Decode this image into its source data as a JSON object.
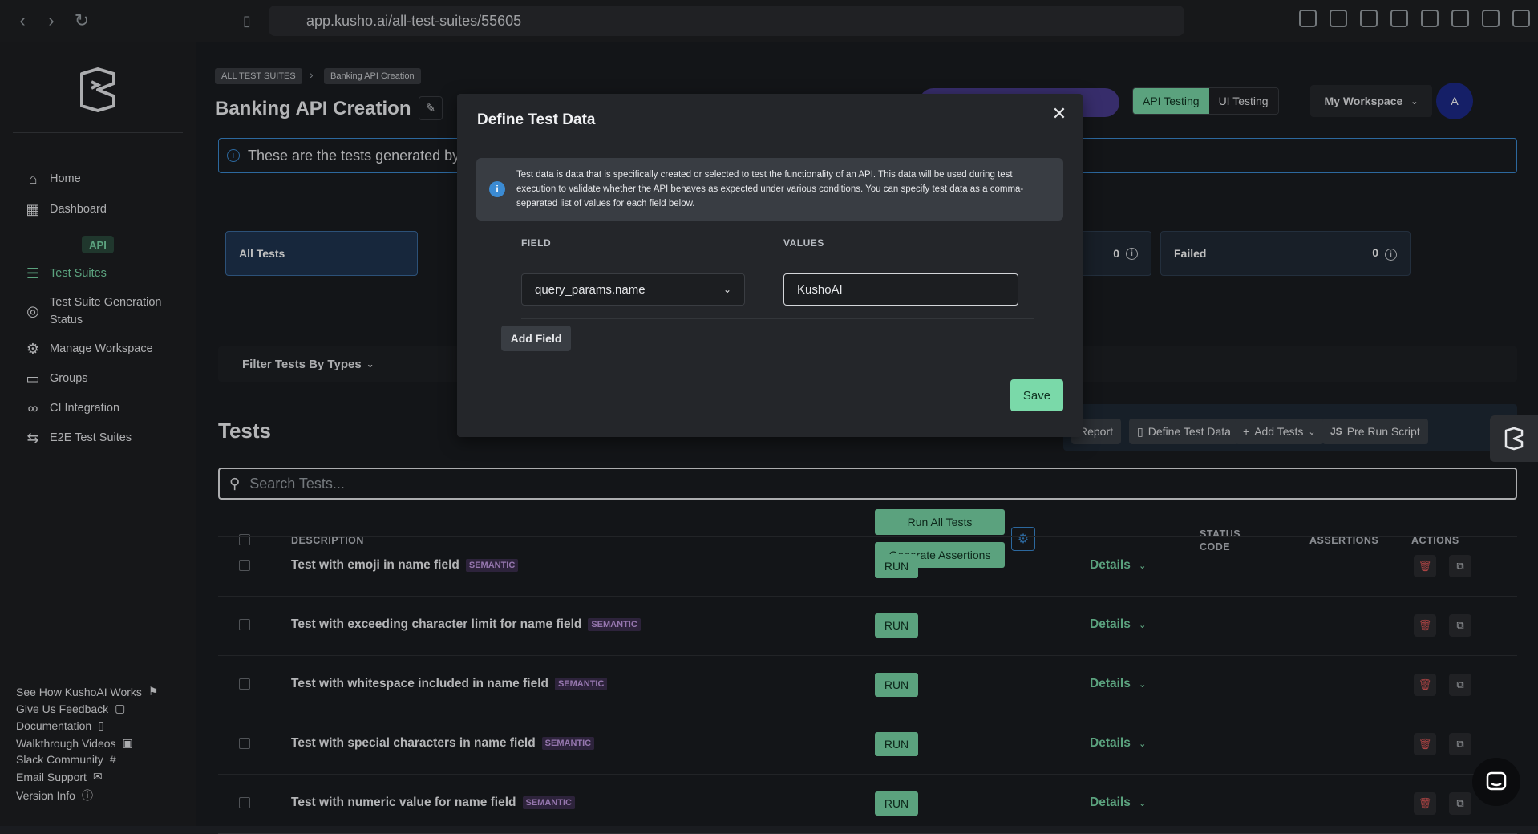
{
  "browser": {
    "url": "app.kusho.ai/all-test-suites/55605"
  },
  "sidebar": {
    "items": [
      {
        "label": "Home",
        "icon": "home-icon"
      },
      {
        "label": "Dashboard",
        "icon": "dashboard-icon"
      }
    ],
    "api_badge": "API",
    "api_items": [
      {
        "label": "Test Suites",
        "icon": "list-check-icon"
      },
      {
        "label": "Test Suite Generation Status",
        "icon": "circle-check-icon"
      },
      {
        "label": "Manage Workspace",
        "icon": "gear-icon"
      },
      {
        "label": "Groups",
        "icon": "folder-icon"
      },
      {
        "label": "CI Integration",
        "icon": "infinity-icon"
      },
      {
        "label": "E2E Test Suites",
        "icon": "e2e-icon"
      }
    ],
    "footer_links": [
      {
        "label": "See How KushoAI Works",
        "icon": "flag-icon"
      },
      {
        "label": "Give Us Feedback",
        "icon": "message-icon"
      },
      {
        "label": "Documentation",
        "icon": "book-icon"
      },
      {
        "label": "Walkthrough Videos",
        "icon": "video-icon"
      },
      {
        "label": "Slack Community",
        "icon": "slack-icon"
      },
      {
        "label": "Email Support",
        "icon": "mail-icon"
      },
      {
        "label": "Version Info",
        "icon": "info-icon"
      }
    ]
  },
  "header": {
    "breadcrumb": [
      "ALL TEST SUITES",
      "Banking API Creation"
    ],
    "title": "Banking API Creation",
    "mode_tabs": [
      "API Testing",
      "UI Testing"
    ],
    "workspace": "My Workspace",
    "avatar": "A"
  },
  "info_bar": "These are the tests generated by K",
  "stats": {
    "all_label": "All Tests",
    "mid_value": "0",
    "failed_label": "Failed",
    "failed_value": "0"
  },
  "filter_label": "Filter Tests By Types",
  "tests_section": {
    "title": "Tests",
    "toolbar": [
      {
        "label": "Report",
        "icon": ""
      },
      {
        "label": "Define Test Data",
        "icon": "file-icon"
      },
      {
        "label": "Add Tests",
        "icon": "plus-icon"
      },
      {
        "label": "Pre Run Script",
        "icon": "js-icon"
      }
    ],
    "search_placeholder": "Search Tests...",
    "columns": {
      "description": "DESCRIPTION",
      "status_code": "STATUS CODE",
      "assertions": "ASSERTIONS",
      "actions": "ACTIONS"
    },
    "run_all": "Run All Tests",
    "generate_assertions": "Generate Assertions",
    "rows": [
      {
        "name": "Test with emoji in name field",
        "tag": "SEMANTIC",
        "run": "RUN",
        "details": "Details"
      },
      {
        "name": "Test with exceeding character limit for name field",
        "tag": "SEMANTIC",
        "run": "RUN",
        "details": "Details"
      },
      {
        "name": "Test with whitespace included in name field",
        "tag": "SEMANTIC",
        "run": "RUN",
        "details": "Details"
      },
      {
        "name": "Test with special characters in name field",
        "tag": "SEMANTIC",
        "run": "RUN",
        "details": "Details"
      },
      {
        "name": "Test with numeric value for name field",
        "tag": "SEMANTIC",
        "run": "RUN",
        "details": "Details"
      }
    ]
  },
  "modal": {
    "title": "Define Test Data",
    "info": "Test data is data that is specifically created or selected to test the functionality of an API. This data will be used during test execution to validate whether the API behaves as expected under various conditions. You can specify test data as a comma-separated list of values for each field below.",
    "field_label": "FIELD",
    "values_label": "VALUES",
    "field_value": "query_params.name",
    "values_value": "KushoAI",
    "add_field": "Add Field",
    "save": "Save"
  },
  "colors": {
    "accent_green": "#7ad9a9",
    "accent_blue": "#3b8bd3",
    "background": "#1a1c20"
  }
}
